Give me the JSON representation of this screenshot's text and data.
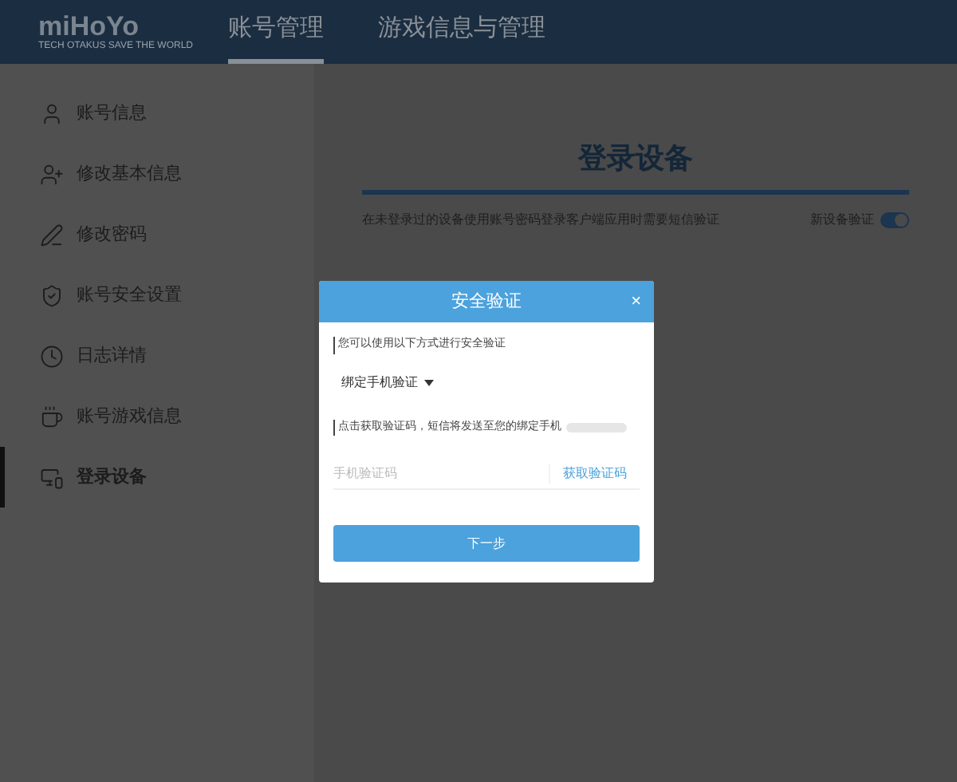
{
  "header": {
    "logo": "miHoYo",
    "tagline": "TECH OTAKUS SAVE THE WORLD",
    "tabs": [
      {
        "label": "账号管理",
        "selected": true
      },
      {
        "label": "游戏信息与管理",
        "selected": false
      }
    ]
  },
  "sidebar": {
    "items": [
      {
        "label": "账号信息",
        "selected": false
      },
      {
        "label": "修改基本信息",
        "selected": false
      },
      {
        "label": "修改密码",
        "selected": false
      },
      {
        "label": "账号安全设置",
        "selected": false
      },
      {
        "label": "日志详情",
        "selected": false
      },
      {
        "label": "账号游戏信息",
        "selected": false
      },
      {
        "label": "登录设备",
        "selected": true
      }
    ]
  },
  "main": {
    "title": "登录设备",
    "description": "在未登录过的设备使用账号密码登录客户端应用时需要短信验证",
    "toggle": {
      "label": "新设备验证",
      "on": true
    }
  },
  "dialog": {
    "title": "安全验证",
    "close": "×",
    "prompt": "您可以使用以下方式进行安全验证",
    "method": "绑定手机验证",
    "notice": "点击获取验证码，短信将发送至您的绑定手机",
    "code_field": {
      "placeholder": "手机验证码"
    },
    "get_code": "获取验证码",
    "next": "下一步"
  }
}
